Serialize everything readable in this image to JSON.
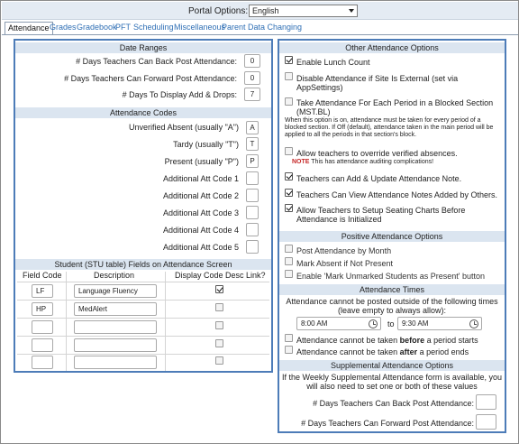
{
  "portal": {
    "label": "Portal Options:",
    "selected": "English"
  },
  "tabs": [
    "Attendance",
    "Grades",
    "Gradebook",
    "PFT",
    "Scheduling",
    "Miscellaneous",
    "Parent Data Changing"
  ],
  "date_ranges": {
    "title": "Date Ranges",
    "rows": [
      {
        "label": "# Days Teachers Can Back Post Attendance:",
        "value": "0"
      },
      {
        "label": "# Days Teachers Can Forward Post Attendance:",
        "value": "0"
      },
      {
        "label": "# Days To Display Add & Drops:",
        "value": "7"
      }
    ]
  },
  "attendance_codes": {
    "title": "Attendance Codes",
    "rows": [
      {
        "label": "Unverified Absent (usually \"A\")",
        "value": "A"
      },
      {
        "label": "Tardy (usually \"T\")",
        "value": "T"
      },
      {
        "label": "Present (usually \"P\")",
        "value": "P"
      },
      {
        "label": "Additional Att Code 1",
        "value": ""
      },
      {
        "label": "Additional Att Code 2",
        "value": ""
      },
      {
        "label": "Additional Att Code 3",
        "value": ""
      },
      {
        "label": "Additional Att Code 4",
        "value": ""
      },
      {
        "label": "Additional Att Code 5",
        "value": ""
      }
    ]
  },
  "student_fields": {
    "title": "Student (STU table) Fields on Attendance Screen",
    "headers": {
      "field_code": "Field Code",
      "description": "Description",
      "display": "Display Code Desc Link?"
    },
    "rows": [
      {
        "code": "LF",
        "desc": "Language Fluency",
        "checked": true
      },
      {
        "code": "HP",
        "desc": "MedAlert",
        "checked": false
      },
      {
        "code": "",
        "desc": "",
        "checked": false
      },
      {
        "code": "",
        "desc": "",
        "checked": false
      },
      {
        "code": "",
        "desc": "",
        "checked": false
      }
    ]
  },
  "other_options": {
    "title": "Other Attendance Options",
    "enable_lunch": "Enable Lunch Count",
    "disable_external": "Disable Attendance if Site Is External (set via AppSettings)",
    "take_each_period": "Take Attendance For Each Period in a Blocked Section (MST.BL)",
    "take_each_period_note": "When this option is on, attendance must be taken for every period of a blocked section. If Off (default), attendance taken in the main period will be applied to all the periods in that section's block.",
    "override_verified": "Allow teachers to override verified absences.",
    "note_label": "NOTE",
    "note_text": "This has attendance auditing complications!",
    "add_update_note": "Teachers can Add & Update Attendance Note.",
    "view_notes": "Teachers Can View Attendance Notes Added by Others.",
    "seating_charts": "Allow Teachers to Setup Seating Charts Before Attendance is Initialized"
  },
  "positive_options": {
    "title": "Positive Attendance Options",
    "post_monthly": "Post Attendance by Month",
    "mark_absent": "Mark Absent if Not Present",
    "enable_mark_present": "Enable 'Mark Unmarked Students as Present' button"
  },
  "attendance_times": {
    "title": "Attendance Times",
    "description": "Attendance cannot be posted outside of the following times (leave empty to always allow):",
    "from": "8:00 AM",
    "to_label": "to",
    "to": "9:30 AM",
    "before_prefix": "Attendance cannot be taken ",
    "before_bold": "before",
    "before_suffix": " a period starts",
    "after_prefix": "Attendance cannot be taken ",
    "after_bold": "after",
    "after_suffix": " a period ends"
  },
  "supplemental": {
    "title": "Supplemental Attendance Options",
    "description": "If the Weekly Supplemental Attendance form is available, you will also need to set one or both of these values",
    "back_label": "# Days Teachers Can Back Post Attendance:",
    "forward_label": "# Days Teachers Can Forward Post Attendance:",
    "back_value": "",
    "forward_value": ""
  }
}
